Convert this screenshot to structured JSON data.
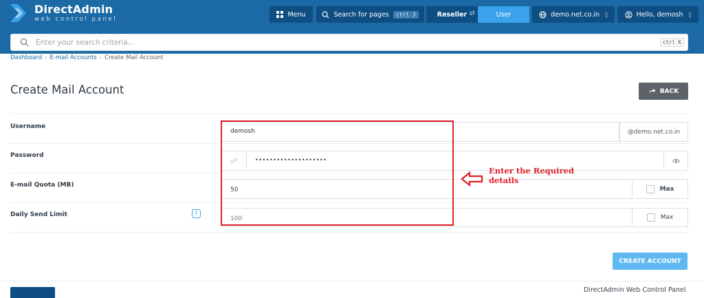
{
  "brand": {
    "title": "DirectAdmin",
    "subtitle": "web control panel"
  },
  "topbar": {
    "menu_label": "Menu",
    "search_pages_label": "Search for pages",
    "search_pages_shortcut": "ctrl J",
    "role_reseller": "Reseller",
    "role_user": "User",
    "domain_label": "demo.net.co.in",
    "greeting": "Hello, demosh"
  },
  "search": {
    "placeholder": "Enter your search criteria...",
    "shortcut": "ctrl K"
  },
  "breadcrumb": {
    "items": [
      "Dashboard",
      "E-mail Accounts",
      "Create Mail Account"
    ]
  },
  "page": {
    "title": "Create Mail Account",
    "back_label": "BACK"
  },
  "form": {
    "username": {
      "label": "Username",
      "value": "demosh",
      "suffix": "@demo.net.co.in"
    },
    "password": {
      "label": "Password",
      "value": "••••••••••••••••••••"
    },
    "quota": {
      "label": "E-mail Quota (MB)",
      "value": "50",
      "max_label": "Max"
    },
    "send_limit": {
      "label": "Daily Send Limit",
      "placeholder": "100",
      "max_label": "Max",
      "help": "?"
    }
  },
  "annotation": {
    "text": "Enter the Required details"
  },
  "actions": {
    "create_label": "CREATE ACCOUNT"
  },
  "footer": {
    "text": "DirectAdmin Web Control Panel"
  },
  "colors": {
    "topbar": "#1b6aa5",
    "topbar_button": "#0e4e82",
    "accent": "#3aa3ec",
    "annotation": "#e01e26"
  }
}
